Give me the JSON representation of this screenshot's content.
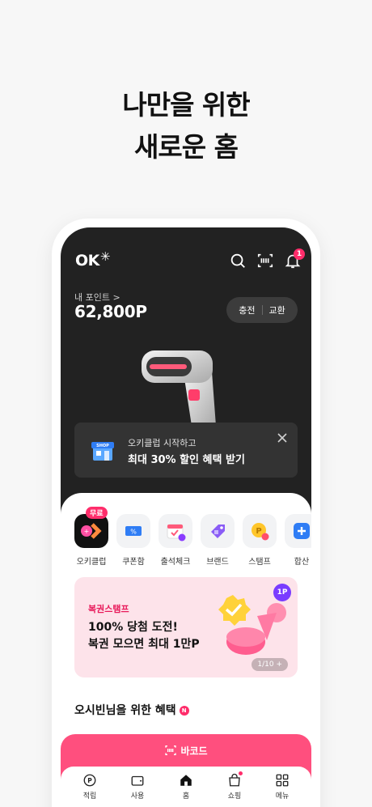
{
  "headline": {
    "line1": "나만을 위한",
    "line2": "새로운 홈"
  },
  "app": {
    "logo": "OK",
    "notification_count": "1",
    "points_label": "내 포인트 >",
    "points_value": "62,800P",
    "charge_label": "충전",
    "exchange_label": "교환",
    "promo": {
      "subtitle": "오키클럽 시작하고",
      "title": "최대 30% 할인 혜택 받기",
      "shop_sign": "SHOP"
    },
    "menu": [
      {
        "label": "오키클럽",
        "icon": "okclub-icon",
        "tag": "무료"
      },
      {
        "label": "쿠폰함",
        "icon": "coupon-icon"
      },
      {
        "label": "출석체크",
        "icon": "calendar-check-icon"
      },
      {
        "label": "브랜드",
        "icon": "brand-tag-icon"
      },
      {
        "label": "스탬프",
        "icon": "stamp-coin-icon"
      },
      {
        "label": "합산",
        "icon": "plus-icon"
      }
    ],
    "banner": {
      "tag": "복권스탬프",
      "line1": "100% 당첨 도전!",
      "line2": "복권 모으면 최대 1만P",
      "point_badge": "1P",
      "pager": "1/10 +"
    },
    "section_title": "오시빈님을 위한 혜택",
    "section_badge": "N",
    "barcode_label": "바코드",
    "tabs": [
      {
        "label": "적립",
        "icon": "point-earn-icon"
      },
      {
        "label": "사용",
        "icon": "wallet-icon"
      },
      {
        "label": "홈",
        "icon": "home-icon"
      },
      {
        "label": "쇼핑",
        "icon": "shopping-bag-icon"
      },
      {
        "label": "메뉴",
        "icon": "grid-menu-icon"
      }
    ]
  },
  "colors": {
    "accent": "#ff2d6b",
    "barcode_bar": "#ff4f7e",
    "dark_bg": "#222222",
    "banner_bg": "#fde3ea"
  }
}
